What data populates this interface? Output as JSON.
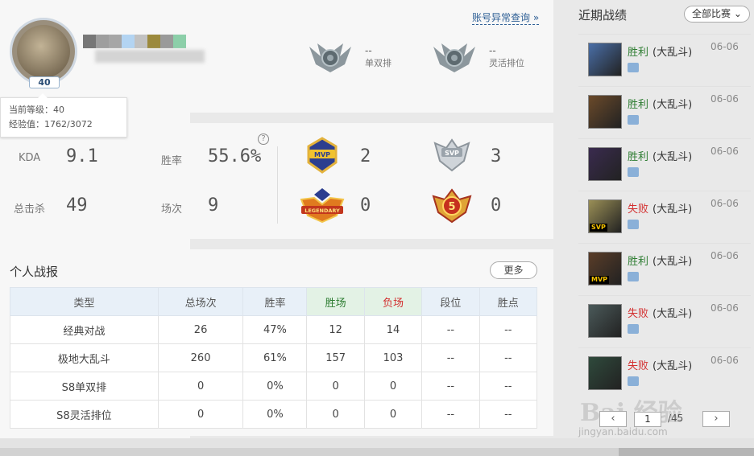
{
  "profile": {
    "level": "40",
    "tooltip": {
      "current_level": "当前等级：40",
      "exp": "经验值：1762/3072"
    },
    "anomaly_link": "账号异常查询 »",
    "ranks": [
      {
        "value": "--",
        "label": "单双排"
      },
      {
        "value": "--",
        "label": "灵活排位"
      }
    ],
    "mosaic_colors": [
      "#777777",
      "#9e9e9e",
      "#a6a6a6",
      "#b3d4f2",
      "#c2c2c2",
      "#9c8a3d",
      "#9a9a9a",
      "#8ccfa9"
    ]
  },
  "stats": {
    "help": "?",
    "items": [
      {
        "label": "KDA",
        "value": "9.1"
      },
      {
        "label": "胜率",
        "value": "55.6%"
      },
      {
        "label": "总击杀",
        "value": "49"
      },
      {
        "label": "场次",
        "value": "9"
      }
    ],
    "medals": [
      {
        "icon": "mvp-medal-icon",
        "text": "MVP",
        "count": "2"
      },
      {
        "icon": "svp-medal-icon",
        "text": "SVP",
        "count": "3"
      },
      {
        "icon": "legendary-medal-icon",
        "text": "LEGENDARY",
        "count": "0"
      },
      {
        "icon": "pentakill-medal-icon",
        "text": "5",
        "count": "0"
      }
    ]
  },
  "report": {
    "title": "个人战报",
    "more_label": "更多",
    "headers": [
      "类型",
      "总场次",
      "胜率",
      "胜场",
      "负场",
      "段位",
      "胜点"
    ],
    "rows": [
      [
        "经典对战",
        "26",
        "47%",
        "12",
        "14",
        "--",
        "--"
      ],
      [
        "极地大乱斗",
        "260",
        "61%",
        "157",
        "103",
        "--",
        "--"
      ],
      [
        "S8单双排",
        "0",
        "0%",
        "0",
        "0",
        "--",
        "--"
      ],
      [
        "S8灵活排位",
        "0",
        "0%",
        "0",
        "0",
        "--",
        "--"
      ]
    ]
  },
  "recent": {
    "title": "近期战绩",
    "filter_label": "全部比赛",
    "matches": [
      {
        "result": "胜利",
        "outcome": "win",
        "mode": "(大乱斗)",
        "date": "06-06",
        "tag": "",
        "color": "#4a6fa8"
      },
      {
        "result": "胜利",
        "outcome": "win",
        "mode": "(大乱斗)",
        "date": "06-06",
        "tag": "",
        "color": "#6b4a2a"
      },
      {
        "result": "胜利",
        "outcome": "win",
        "mode": "(大乱斗)",
        "date": "06-06",
        "tag": "",
        "color": "#3a2b4f"
      },
      {
        "result": "失败",
        "outcome": "loss",
        "mode": "(大乱斗)",
        "date": "06-06",
        "tag": "SVP",
        "color": "#9a8f56"
      },
      {
        "result": "胜利",
        "outcome": "win",
        "mode": "(大乱斗)",
        "date": "06-06",
        "tag": "MVP",
        "color": "#5a3d28"
      },
      {
        "result": "失败",
        "outcome": "loss",
        "mode": "(大乱斗)",
        "date": "06-06",
        "tag": "",
        "color": "#4b5a5a"
      },
      {
        "result": "失败",
        "outcome": "loss",
        "mode": "(大乱斗)",
        "date": "06-06",
        "tag": "",
        "color": "#2f4a3c"
      }
    ],
    "pager": {
      "prev": "‹",
      "current": "1",
      "total": "/45",
      "next": "›"
    }
  },
  "watermark": {
    "main": "Bai 经验",
    "sub": "jingyan.baidu.com"
  }
}
